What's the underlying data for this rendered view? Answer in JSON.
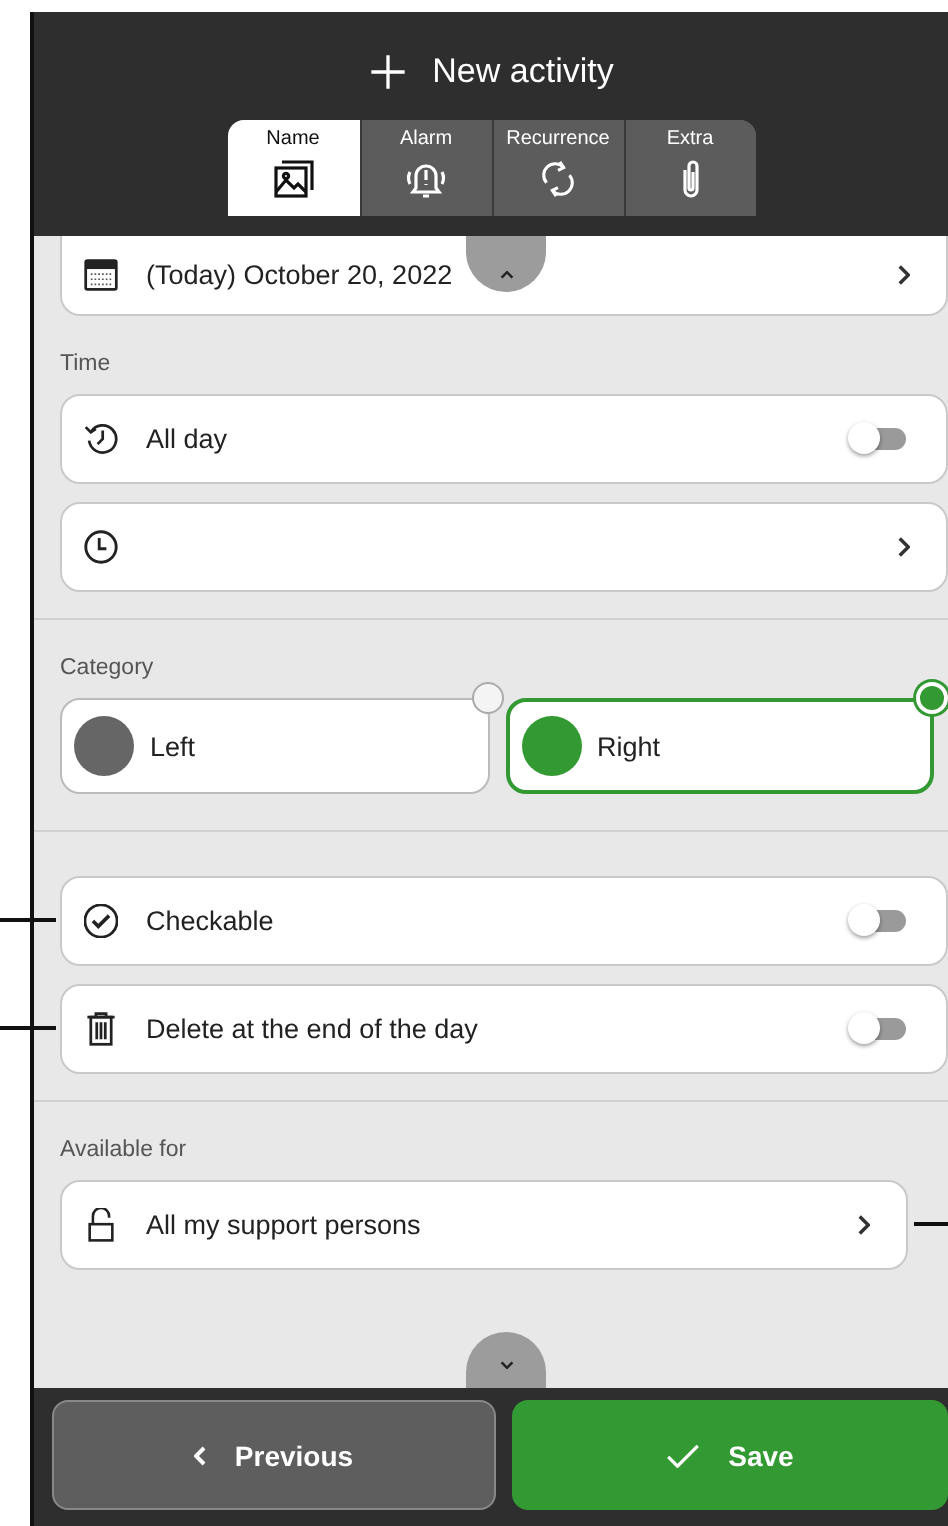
{
  "header": {
    "title": "New activity"
  },
  "tabs": [
    {
      "label": "Name",
      "selected": true
    },
    {
      "label": "Alarm",
      "selected": false
    },
    {
      "label": "Recurrence",
      "selected": false
    },
    {
      "label": "Extra",
      "selected": false
    }
  ],
  "date": {
    "value": "(Today) October 20, 2022"
  },
  "time": {
    "label": "Time",
    "all_day": {
      "label": "All day",
      "on": false
    }
  },
  "category": {
    "label": "Category",
    "options": [
      {
        "label": "Left",
        "color": "#666666",
        "selected": false
      },
      {
        "label": "Right",
        "color": "#339933",
        "selected": true
      }
    ]
  },
  "checkable": {
    "label": "Checkable",
    "on": false
  },
  "delete_end_of_day": {
    "label": "Delete at the end of the day",
    "on": false
  },
  "available_for": {
    "label": "Available for",
    "value": "All my support persons"
  },
  "footer": {
    "previous": "Previous",
    "save": "Save"
  }
}
